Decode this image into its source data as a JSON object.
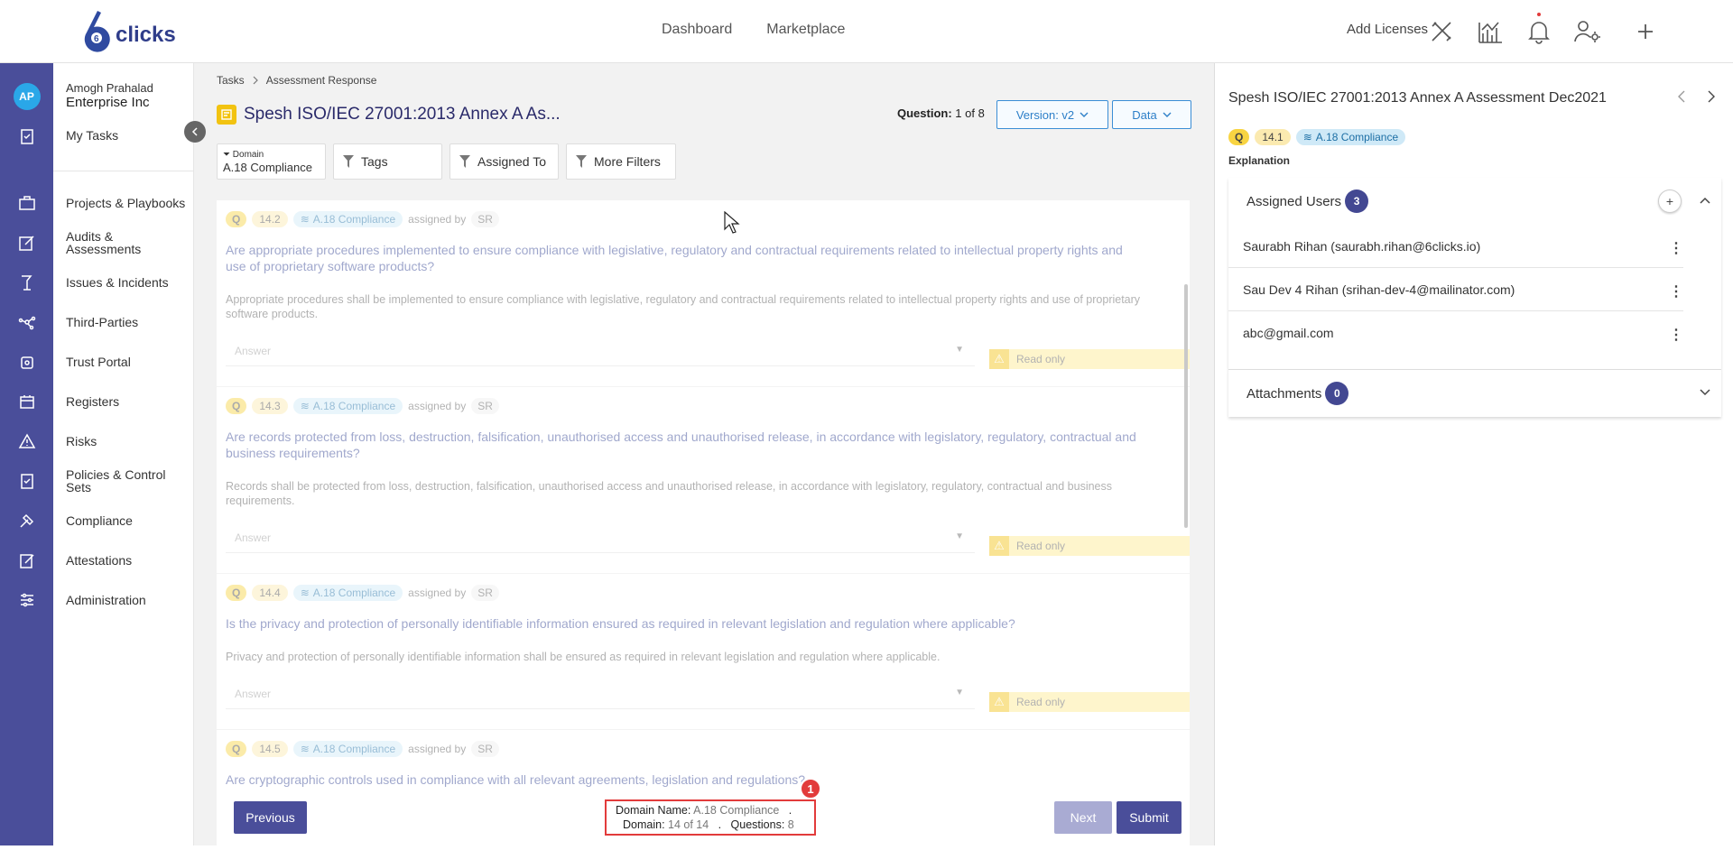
{
  "app": {
    "logo_text": "clicks",
    "logo_digit": "6"
  },
  "topnav": {
    "dashboard": "Dashboard",
    "marketplace": "Marketplace",
    "add_licenses": "Add Licenses"
  },
  "user": {
    "avatar": "AP",
    "name": "Amogh Prahalad",
    "org": "Enterprise Inc"
  },
  "sidenav": {
    "my_tasks": "My Tasks",
    "items": [
      "Projects & Playbooks",
      "Audits & Assessments",
      "Issues & Incidents",
      "Third-Parties",
      "Trust Portal",
      "Registers",
      "Risks",
      "Policies & Control Sets",
      "Compliance",
      "Attestations",
      "Administration"
    ]
  },
  "breadcrumb": {
    "root": "Tasks",
    "current": "Assessment Response"
  },
  "header": {
    "title": "Spesh ISO/IEC 27001:2013 Annex A As...",
    "question_label": "Question:",
    "question_value": "1 of 8",
    "version": "Version: v2",
    "data": "Data"
  },
  "filters": {
    "domain_label": "Domain",
    "domain_value": "A.18 Compliance",
    "tags": "Tags",
    "assigned_to": "Assigned To",
    "more": "More Filters"
  },
  "questions": [
    {
      "tag": "Q",
      "num": "14.2",
      "domain": "A.18 Compliance",
      "by": "assigned by",
      "sr": "SR",
      "text": "Are appropriate procedures implemented to ensure compliance with legislative, regulatory and contractual requirements related to intellectual property rights and use of proprietary software products?",
      "desc": "Appropriate procedures shall be implemented to ensure compliance with legislative, regulatory and contractual requirements related to intellectual property rights and use of proprietary software products.",
      "answer": "Answer",
      "readonly": "Read only"
    },
    {
      "tag": "Q",
      "num": "14.3",
      "domain": "A.18 Compliance",
      "by": "assigned by",
      "sr": "SR",
      "text": "Are records protected from loss, destruction, falsification, unauthorised access and unauthorised release, in accordance with legislatory, regulatory, contractual and business requirements?",
      "desc": "Records shall be protected from loss, destruction, falsification, unauthorised access and unauthorised release, in accordance with legislatory, regulatory, contractual and business requirements.",
      "answer": "Answer",
      "readonly": "Read only"
    },
    {
      "tag": "Q",
      "num": "14.4",
      "domain": "A.18 Compliance",
      "by": "assigned by",
      "sr": "SR",
      "text": "Is the privacy and protection of personally identifiable information ensured as required in relevant legislation and regulation where applicable?",
      "desc": "Privacy and protection of personally identifiable information shall be ensured as required in relevant legislation and regulation where applicable.",
      "answer": "Answer",
      "readonly": "Read only"
    },
    {
      "tag": "Q",
      "num": "14.5",
      "domain": "A.18 Compliance",
      "by": "assigned by",
      "sr": "SR",
      "text": "Are cryptographic controls used in compliance with all relevant agreements, legislation and regulations?"
    }
  ],
  "footer": {
    "previous": "Previous",
    "next": "Next",
    "submit": "Submit",
    "domain_name_label": "Domain Name:",
    "domain_name_value": "A.18 Compliance",
    "domain_label": "Domain:",
    "domain_value": "14 of 14",
    "questions_label": "Questions:",
    "questions_value": "8",
    "sep": ".",
    "badge": "1"
  },
  "right_panel": {
    "title": "Spesh ISO/IEC 27001:2013 Annex A Assessment Dec2021",
    "tag": "Q",
    "num": "14.1",
    "domain": "A.18 Compliance",
    "explanation": "Explanation",
    "assigned_users_label": "Assigned Users",
    "assigned_count": "3",
    "users": [
      "Saurabh Rihan (saurabh.rihan@6clicks.io)",
      "Sau Dev 4 Rihan (srihan-dev-4@mailinator.com)",
      "abc@gmail.com"
    ],
    "attachments_label": "Attachments",
    "attachments_count": "0"
  },
  "colors": {
    "rail": "#4a4e9a",
    "primary": "#434892",
    "accent_yellow": "#f2c311",
    "link_blue": "#2d7fc8",
    "highlight_red": "#e23b3b"
  }
}
